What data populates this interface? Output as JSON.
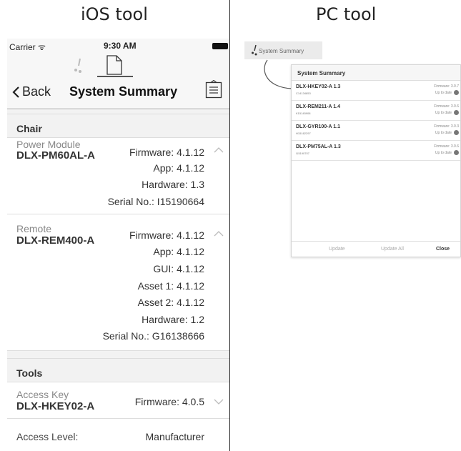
{
  "headings": {
    "ios": "iOS  tool",
    "pc": "PC  tool"
  },
  "ios": {
    "status": {
      "carrier": "Carrier ᯤ",
      "time": "9:30 AM"
    },
    "nav": {
      "back": "Back",
      "title": "System Summary"
    },
    "chair_section": "Chair",
    "power_module": {
      "label": "Power Module",
      "model": "DLX-PM60AL-A",
      "firmware": "Firmware: 4.1.12",
      "app": "App: 4.1.12",
      "hardware": "Hardware: 1.3",
      "serial": "Serial No.: I15190664"
    },
    "remote": {
      "label": "Remote",
      "model": "DLX-REM400-A",
      "firmware": "Firmware: 4.1.12",
      "app": "App: 4.1.12",
      "gui": "GUI: 4.1.12",
      "asset1": "Asset 1: 4.1.12",
      "asset2": "Asset 2: 4.1.12",
      "hardware": "Hardware: 1.2",
      "serial": "Serial No.: G16138666"
    },
    "tools_section": "Tools",
    "access_key": {
      "label": "Access Key",
      "model": "DLX-HKEY02-A",
      "firmware": "Firmware: 4.0.5"
    },
    "access_level": {
      "label": "Access Level:",
      "value": "Manufacturer"
    }
  },
  "pc": {
    "tab_label": "System Summary",
    "dialog_title": "System Summary",
    "devices": [
      {
        "name": "DLX-HKEY02-A 1.3",
        "serial": "C14134853",
        "firmware": "Firmware: 3.0.7",
        "status": "Up to date"
      },
      {
        "name": "DLX-REM211-A 1.4",
        "serial": "K15145908",
        "firmware": "Firmware: 3.0.6",
        "status": "Up to date"
      },
      {
        "name": "DLX-GYR100-A 1.1",
        "serial": "H15162297",
        "firmware": "Firmware: 3.0.3",
        "status": "Up to date"
      },
      {
        "name": "DLX-PM75AL-A 1.3",
        "serial": "I15190707",
        "firmware": "Firmware: 3.0.6",
        "status": "Up to date"
      }
    ],
    "buttons": {
      "update": "Update",
      "update_all": "Update All",
      "close": "Close"
    }
  }
}
